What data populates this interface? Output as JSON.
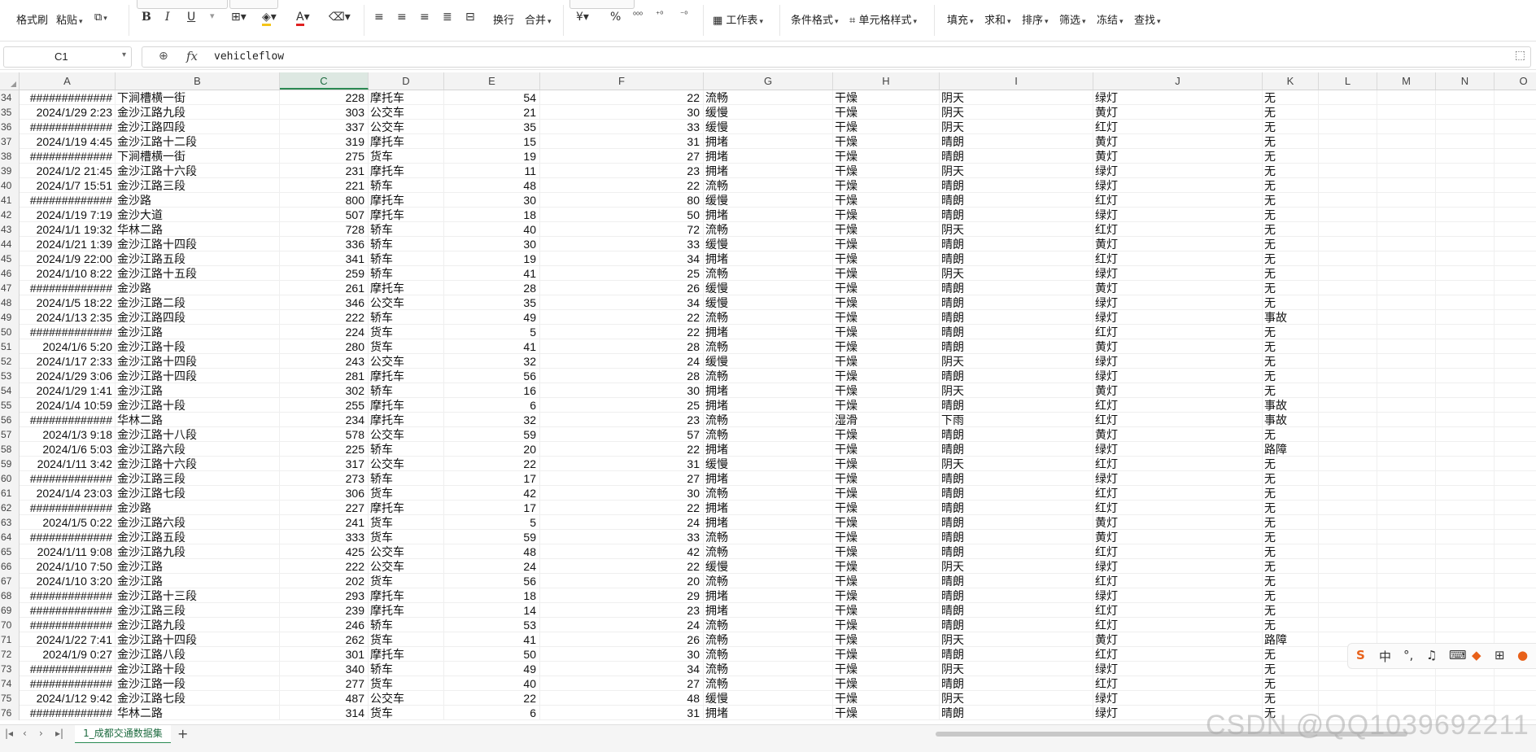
{
  "ribbon": {
    "format_painter": "格式刷",
    "paste": "粘贴",
    "bold": "B",
    "italic": "I",
    "underline": "U",
    "wrap": "换行",
    "merge": "合并",
    "currency": "¥",
    "percent": "%",
    "sheet": "工作表",
    "cond_format": "条件格式",
    "cell_style": "单元格样式",
    "fill": "填充",
    "sum": "求和",
    "sort": "排序",
    "filter": "筛选",
    "freeze": "冻结",
    "find": "查找"
  },
  "formula_bar": {
    "cell_ref": "C1",
    "fx": "fx",
    "formula": "vehicleflow"
  },
  "columns": [
    "A",
    "B",
    "C",
    "D",
    "E",
    "F",
    "G",
    "H",
    "I",
    "J",
    "K",
    "L",
    "M",
    "N",
    "O"
  ],
  "selected_column": "C",
  "rows": [
    {
      "n": "34",
      "a": "#############",
      "b": "下涧槽横一街",
      "c": "228",
      "d": "摩托车",
      "e": "54",
      "f": "22",
      "g": "流畅",
      "h": "干燥",
      "i": "阴天",
      "j": "绿灯",
      "k": "无"
    },
    {
      "n": "35",
      "a": "2024/1/29 2:23",
      "b": "金沙江路九段",
      "c": "303",
      "d": "公交车",
      "e": "21",
      "f": "30",
      "g": "缓慢",
      "h": "干燥",
      "i": "阴天",
      "j": "黄灯",
      "k": "无"
    },
    {
      "n": "36",
      "a": "#############",
      "b": "金沙江路四段",
      "c": "337",
      "d": "公交车",
      "e": "35",
      "f": "33",
      "g": "缓慢",
      "h": "干燥",
      "i": "阴天",
      "j": "红灯",
      "k": "无"
    },
    {
      "n": "37",
      "a": "2024/1/19 4:45",
      "b": "金沙江路十二段",
      "c": "319",
      "d": "摩托车",
      "e": "15",
      "f": "31",
      "g": "拥堵",
      "h": "干燥",
      "i": "晴朗",
      "j": "黄灯",
      "k": "无"
    },
    {
      "n": "38",
      "a": "#############",
      "b": "下涧槽横一街",
      "c": "275",
      "d": "货车",
      "e": "19",
      "f": "27",
      "g": "拥堵",
      "h": "干燥",
      "i": "晴朗",
      "j": "黄灯",
      "k": "无"
    },
    {
      "n": "39",
      "a": "2024/1/2 21:45",
      "b": "金沙江路十六段",
      "c": "231",
      "d": "摩托车",
      "e": "11",
      "f": "23",
      "g": "拥堵",
      "h": "干燥",
      "i": "阴天",
      "j": "绿灯",
      "k": "无"
    },
    {
      "n": "40",
      "a": "2024/1/7 15:51",
      "b": "金沙江路三段",
      "c": "221",
      "d": "轿车",
      "e": "48",
      "f": "22",
      "g": "流畅",
      "h": "干燥",
      "i": "晴朗",
      "j": "绿灯",
      "k": "无"
    },
    {
      "n": "41",
      "a": "#############",
      "b": "金沙路",
      "c": "800",
      "d": "摩托车",
      "e": "30",
      "f": "80",
      "g": "缓慢",
      "h": "干燥",
      "i": "晴朗",
      "j": "红灯",
      "k": "无"
    },
    {
      "n": "42",
      "a": "2024/1/19 7:19",
      "b": "金沙大道",
      "c": "507",
      "d": "摩托车",
      "e": "18",
      "f": "50",
      "g": "拥堵",
      "h": "干燥",
      "i": "晴朗",
      "j": "绿灯",
      "k": "无"
    },
    {
      "n": "43",
      "a": "2024/1/1 19:32",
      "b": "华林二路",
      "c": "728",
      "d": "轿车",
      "e": "40",
      "f": "72",
      "g": "流畅",
      "h": "干燥",
      "i": "阴天",
      "j": "红灯",
      "k": "无"
    },
    {
      "n": "44",
      "a": "2024/1/21 1:39",
      "b": "金沙江路十四段",
      "c": "336",
      "d": "轿车",
      "e": "30",
      "f": "33",
      "g": "缓慢",
      "h": "干燥",
      "i": "晴朗",
      "j": "黄灯",
      "k": "无"
    },
    {
      "n": "45",
      "a": "2024/1/9 22:00",
      "b": "金沙江路五段",
      "c": "341",
      "d": "轿车",
      "e": "19",
      "f": "34",
      "g": "拥堵",
      "h": "干燥",
      "i": "晴朗",
      "j": "红灯",
      "k": "无"
    },
    {
      "n": "46",
      "a": "2024/1/10 8:22",
      "b": "金沙江路十五段",
      "c": "259",
      "d": "轿车",
      "e": "41",
      "f": "25",
      "g": "流畅",
      "h": "干燥",
      "i": "阴天",
      "j": "绿灯",
      "k": "无"
    },
    {
      "n": "47",
      "a": "#############",
      "b": "金沙路",
      "c": "261",
      "d": "摩托车",
      "e": "28",
      "f": "26",
      "g": "缓慢",
      "h": "干燥",
      "i": "晴朗",
      "j": "黄灯",
      "k": "无"
    },
    {
      "n": "48",
      "a": "2024/1/5 18:22",
      "b": "金沙江路二段",
      "c": "346",
      "d": "公交车",
      "e": "35",
      "f": "34",
      "g": "缓慢",
      "h": "干燥",
      "i": "晴朗",
      "j": "绿灯",
      "k": "无"
    },
    {
      "n": "49",
      "a": "2024/1/13 2:35",
      "b": "金沙江路四段",
      "c": "222",
      "d": "轿车",
      "e": "49",
      "f": "22",
      "g": "流畅",
      "h": "干燥",
      "i": "晴朗",
      "j": "绿灯",
      "k": "事故"
    },
    {
      "n": "50",
      "a": "#############",
      "b": "金沙江路",
      "c": "224",
      "d": "货车",
      "e": "5",
      "f": "22",
      "g": "拥堵",
      "h": "干燥",
      "i": "晴朗",
      "j": "红灯",
      "k": "无"
    },
    {
      "n": "51",
      "a": "2024/1/6 5:20",
      "b": "金沙江路十段",
      "c": "280",
      "d": "货车",
      "e": "41",
      "f": "28",
      "g": "流畅",
      "h": "干燥",
      "i": "晴朗",
      "j": "黄灯",
      "k": "无"
    },
    {
      "n": "52",
      "a": "2024/1/17 2:33",
      "b": "金沙江路十四段",
      "c": "243",
      "d": "公交车",
      "e": "32",
      "f": "24",
      "g": "缓慢",
      "h": "干燥",
      "i": "阴天",
      "j": "绿灯",
      "k": "无"
    },
    {
      "n": "53",
      "a": "2024/1/29 3:06",
      "b": "金沙江路十四段",
      "c": "281",
      "d": "摩托车",
      "e": "56",
      "f": "28",
      "g": "流畅",
      "h": "干燥",
      "i": "晴朗",
      "j": "绿灯",
      "k": "无"
    },
    {
      "n": "54",
      "a": "2024/1/29 1:41",
      "b": "金沙江路",
      "c": "302",
      "d": "轿车",
      "e": "16",
      "f": "30",
      "g": "拥堵",
      "h": "干燥",
      "i": "阴天",
      "j": "黄灯",
      "k": "无"
    },
    {
      "n": "55",
      "a": "2024/1/4 10:59",
      "b": "金沙江路十段",
      "c": "255",
      "d": "摩托车",
      "e": "6",
      "f": "25",
      "g": "拥堵",
      "h": "干燥",
      "i": "晴朗",
      "j": "红灯",
      "k": "事故"
    },
    {
      "n": "56",
      "a": "#############",
      "b": "华林二路",
      "c": "234",
      "d": "摩托车",
      "e": "32",
      "f": "23",
      "g": "流畅",
      "h": "湿滑",
      "i": "下雨",
      "j": "红灯",
      "k": "事故"
    },
    {
      "n": "57",
      "a": "2024/1/3 9:18",
      "b": "金沙江路十八段",
      "c": "578",
      "d": "公交车",
      "e": "59",
      "f": "57",
      "g": "流畅",
      "h": "干燥",
      "i": "晴朗",
      "j": "黄灯",
      "k": "无"
    },
    {
      "n": "58",
      "a": "2024/1/6 5:03",
      "b": "金沙江路六段",
      "c": "225",
      "d": "轿车",
      "e": "20",
      "f": "22",
      "g": "拥堵",
      "h": "干燥",
      "i": "晴朗",
      "j": "绿灯",
      "k": "路障"
    },
    {
      "n": "59",
      "a": "2024/1/11 3:42",
      "b": "金沙江路十六段",
      "c": "317",
      "d": "公交车",
      "e": "22",
      "f": "31",
      "g": "缓慢",
      "h": "干燥",
      "i": "阴天",
      "j": "红灯",
      "k": "无"
    },
    {
      "n": "60",
      "a": "#############",
      "b": "金沙江路三段",
      "c": "273",
      "d": "轿车",
      "e": "17",
      "f": "27",
      "g": "拥堵",
      "h": "干燥",
      "i": "晴朗",
      "j": "绿灯",
      "k": "无"
    },
    {
      "n": "61",
      "a": "2024/1/4 23:03",
      "b": "金沙江路七段",
      "c": "306",
      "d": "货车",
      "e": "42",
      "f": "30",
      "g": "流畅",
      "h": "干燥",
      "i": "晴朗",
      "j": "红灯",
      "k": "无"
    },
    {
      "n": "62",
      "a": "#############",
      "b": "金沙路",
      "c": "227",
      "d": "摩托车",
      "e": "17",
      "f": "22",
      "g": "拥堵",
      "h": "干燥",
      "i": "晴朗",
      "j": "红灯",
      "k": "无"
    },
    {
      "n": "63",
      "a": "2024/1/5 0:22",
      "b": "金沙江路六段",
      "c": "241",
      "d": "货车",
      "e": "5",
      "f": "24",
      "g": "拥堵",
      "h": "干燥",
      "i": "晴朗",
      "j": "黄灯",
      "k": "无"
    },
    {
      "n": "64",
      "a": "#############",
      "b": "金沙江路五段",
      "c": "333",
      "d": "货车",
      "e": "59",
      "f": "33",
      "g": "流畅",
      "h": "干燥",
      "i": "晴朗",
      "j": "黄灯",
      "k": "无"
    },
    {
      "n": "65",
      "a": "2024/1/11 9:08",
      "b": "金沙江路九段",
      "c": "425",
      "d": "公交车",
      "e": "48",
      "f": "42",
      "g": "流畅",
      "h": "干燥",
      "i": "晴朗",
      "j": "红灯",
      "k": "无"
    },
    {
      "n": "66",
      "a": "2024/1/10 7:50",
      "b": "金沙江路",
      "c": "222",
      "d": "公交车",
      "e": "24",
      "f": "22",
      "g": "缓慢",
      "h": "干燥",
      "i": "阴天",
      "j": "绿灯",
      "k": "无"
    },
    {
      "n": "67",
      "a": "2024/1/10 3:20",
      "b": "金沙江路",
      "c": "202",
      "d": "货车",
      "e": "56",
      "f": "20",
      "g": "流畅",
      "h": "干燥",
      "i": "晴朗",
      "j": "红灯",
      "k": "无"
    },
    {
      "n": "68",
      "a": "#############",
      "b": "金沙江路十三段",
      "c": "293",
      "d": "摩托车",
      "e": "18",
      "f": "29",
      "g": "拥堵",
      "h": "干燥",
      "i": "晴朗",
      "j": "绿灯",
      "k": "无"
    },
    {
      "n": "69",
      "a": "#############",
      "b": "金沙江路三段",
      "c": "239",
      "d": "摩托车",
      "e": "14",
      "f": "23",
      "g": "拥堵",
      "h": "干燥",
      "i": "晴朗",
      "j": "红灯",
      "k": "无"
    },
    {
      "n": "70",
      "a": "#############",
      "b": "金沙江路九段",
      "c": "246",
      "d": "轿车",
      "e": "53",
      "f": "24",
      "g": "流畅",
      "h": "干燥",
      "i": "晴朗",
      "j": "红灯",
      "k": "无"
    },
    {
      "n": "71",
      "a": "2024/1/22 7:41",
      "b": "金沙江路十四段",
      "c": "262",
      "d": "货车",
      "e": "41",
      "f": "26",
      "g": "流畅",
      "h": "干燥",
      "i": "阴天",
      "j": "黄灯",
      "k": "路障"
    },
    {
      "n": "72",
      "a": "2024/1/9 0:27",
      "b": "金沙江路八段",
      "c": "301",
      "d": "摩托车",
      "e": "50",
      "f": "30",
      "g": "流畅",
      "h": "干燥",
      "i": "晴朗",
      "j": "红灯",
      "k": "无"
    },
    {
      "n": "73",
      "a": "#############",
      "b": "金沙江路十段",
      "c": "340",
      "d": "轿车",
      "e": "49",
      "f": "34",
      "g": "流畅",
      "h": "干燥",
      "i": "阴天",
      "j": "绿灯",
      "k": "无"
    },
    {
      "n": "74",
      "a": "#############",
      "b": "金沙江路一段",
      "c": "277",
      "d": "货车",
      "e": "40",
      "f": "27",
      "g": "流畅",
      "h": "干燥",
      "i": "晴朗",
      "j": "红灯",
      "k": "无"
    },
    {
      "n": "75",
      "a": "2024/1/12 9:42",
      "b": "金沙江路七段",
      "c": "487",
      "d": "公交车",
      "e": "22",
      "f": "48",
      "g": "缓慢",
      "h": "干燥",
      "i": "阴天",
      "j": "绿灯",
      "k": "无"
    },
    {
      "n": "76",
      "a": "#############",
      "b": "华林二路",
      "c": "314",
      "d": "货车",
      "e": "6",
      "f": "31",
      "g": "拥堵",
      "h": "干燥",
      "i": "晴朗",
      "j": "绿灯",
      "k": "无"
    }
  ],
  "sheet_tabs": [
    "1_成都交通数据集"
  ],
  "watermark": "CSDN @QQ1039692211",
  "ime": {
    "mode": "中"
  },
  "colors": {
    "accent": "#2a8a52",
    "header_bg": "#f3f3f3",
    "selected_header": "#dde8e2"
  }
}
